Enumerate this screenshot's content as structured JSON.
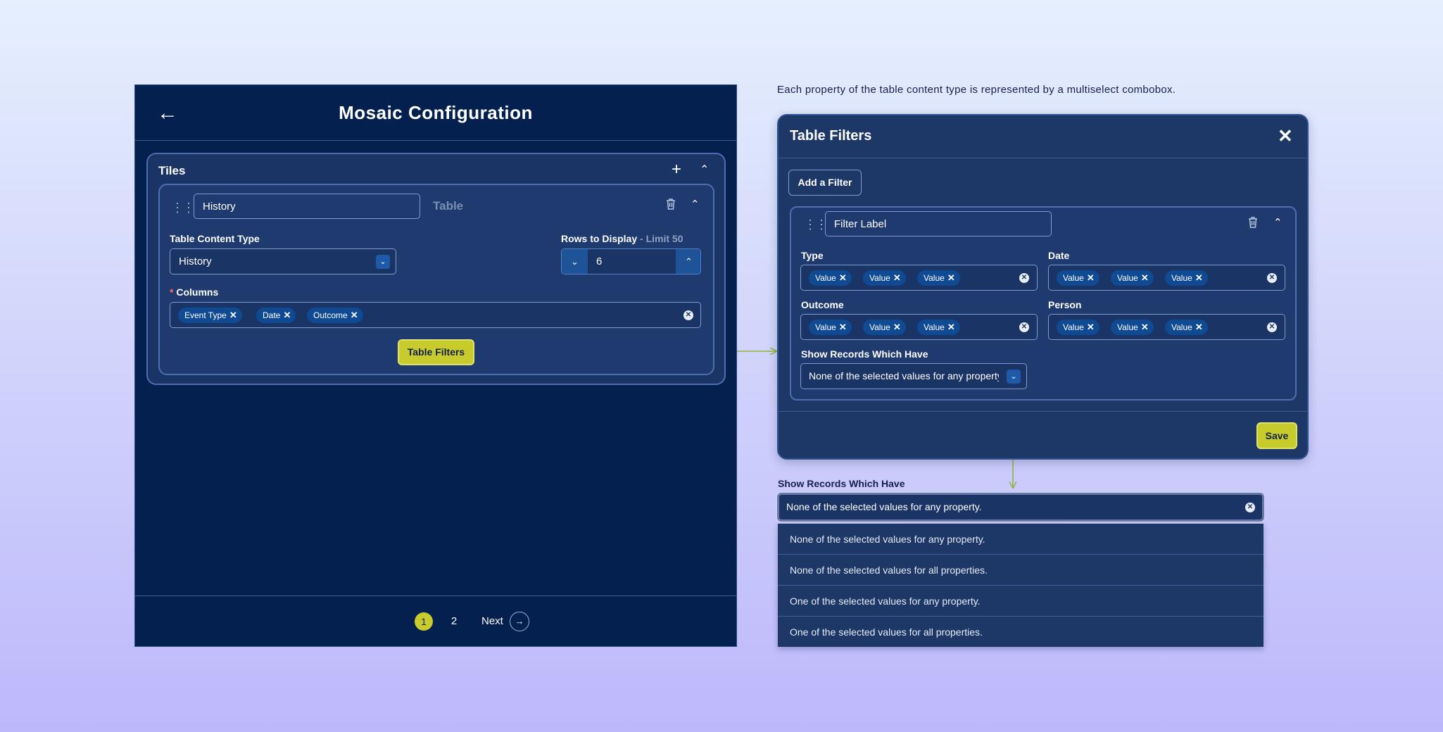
{
  "mosaic": {
    "title": "Mosaic Configuration",
    "tiles": {
      "label": "Tiles",
      "tile": {
        "name_value": "History",
        "type_label": "Table",
        "table_content_type": {
          "label": "Table Content Type",
          "value": "History"
        },
        "rows_to_display": {
          "label": "Rows to Display",
          "limit": "- Limit 50",
          "value": "6"
        },
        "columns": {
          "required_mark": "*",
          "label": "Columns",
          "chips": [
            "Event Type",
            "Date",
            "Outcome"
          ]
        },
        "table_filters_button": "Table Filters"
      }
    },
    "pagination": {
      "pages": [
        "1",
        "2"
      ],
      "current": "1",
      "next_label": "Next"
    }
  },
  "caption": "Each property of the table content type is represented by a multiselect combobox.",
  "table_filters": {
    "title": "Table Filters",
    "add_filter_button": "Add a Filter",
    "filter": {
      "label_value": "Filter Label",
      "properties": [
        {
          "label": "Type",
          "chips": [
            "Value",
            "Value",
            "Value"
          ]
        },
        {
          "label": "Date",
          "chips": [
            "Value",
            "Value",
            "Value"
          ]
        },
        {
          "label": "Outcome",
          "chips": [
            "Value",
            "Value",
            "Value"
          ]
        },
        {
          "label": "Person",
          "chips": [
            "Value",
            "Value",
            "Value"
          ]
        }
      ],
      "show_records": {
        "label": "Show Records Which Have",
        "value": "None of the selected values for any property."
      }
    },
    "save_button": "Save"
  },
  "show_records_dropdown": {
    "label": "Show Records Which Have",
    "value": "None of the selected values for any property.",
    "options": [
      "None of the selected values for any property.",
      "None of the selected values for all properties.",
      "One of the selected values for any property.",
      "One of the selected values for all properties."
    ]
  },
  "colors": {
    "panel_bg": "#03204f",
    "card_bg": "#1f3a6e",
    "accent": "#c8cb2c",
    "chip_bg": "#0f4a93",
    "connector": "#8fb33a"
  }
}
